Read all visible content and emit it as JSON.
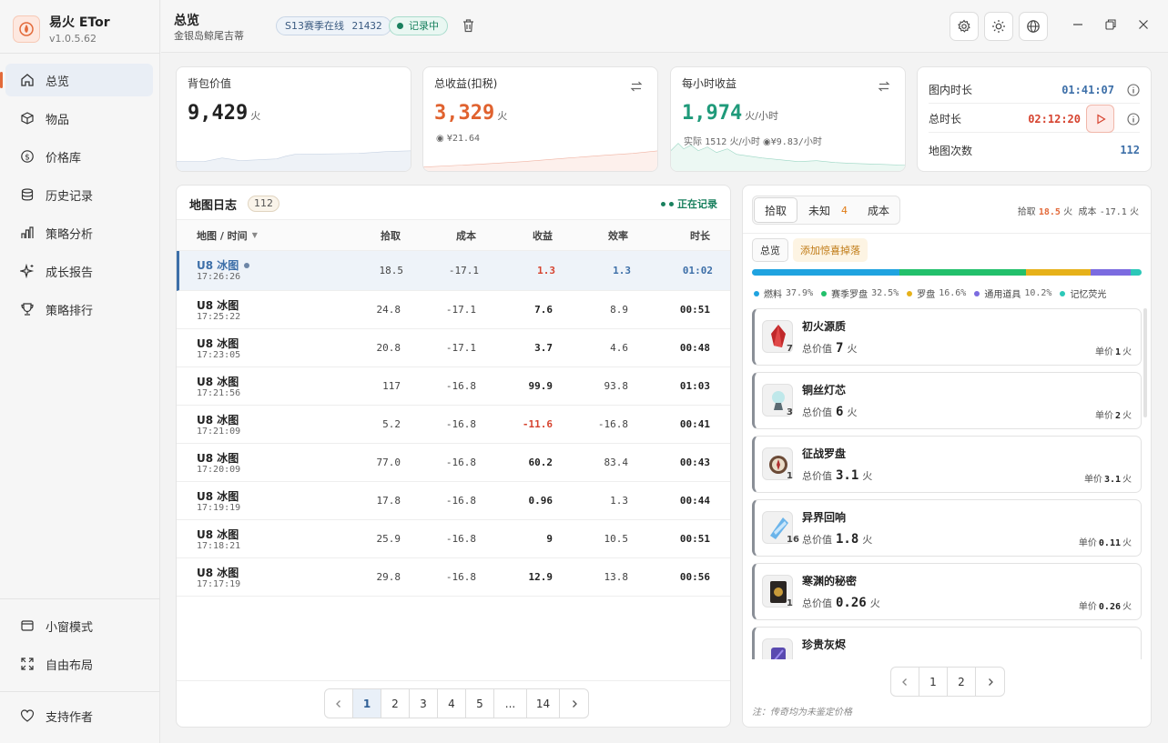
{
  "app": {
    "name": "易火 ETor",
    "version": "v1.0.5.62"
  },
  "sidebar": {
    "items": [
      {
        "label": "总览",
        "icon": "home-icon"
      },
      {
        "label": "物品",
        "icon": "box-icon"
      },
      {
        "label": "价格库",
        "icon": "dollar-icon"
      },
      {
        "label": "历史记录",
        "icon": "database-icon"
      },
      {
        "label": "策略分析",
        "icon": "bar-chart-icon"
      },
      {
        "label": "成长报告",
        "icon": "sparkle-icon"
      },
      {
        "label": "策略排行",
        "icon": "trophy-icon"
      }
    ],
    "bottom": [
      {
        "label": "小窗模式",
        "icon": "window-icon"
      },
      {
        "label": "自由布局",
        "icon": "expand-icon"
      },
      {
        "label": "支持作者",
        "icon": "heart-icon"
      }
    ]
  },
  "header": {
    "title": "总览",
    "subtitle": "金银岛鲸尾吉蒂",
    "season_label": "S13赛季在线",
    "season_count": "21432",
    "recording_label": "记录中"
  },
  "stats": {
    "bag": {
      "label": "背包价值",
      "value": "9,429",
      "unit": "火"
    },
    "profit": {
      "label": "总收益(扣税)",
      "value": "3,329",
      "unit": "火",
      "note": "¥21.64"
    },
    "hourly": {
      "label": "每小时收益",
      "value": "1,974",
      "unit": "火/小时",
      "note_label": "实际",
      "note_actual": "1512",
      "note_unit": "火/小时",
      "note_money": "¥9.83/小时"
    },
    "timers": {
      "in_map_label": "图内时长",
      "in_map_value": "01:41:07",
      "total_label": "总时长",
      "total_value": "02:12:20",
      "maps_label": "地图次数",
      "maps_value": "112"
    }
  },
  "map_log": {
    "title": "地图日志",
    "count": "112",
    "live_label": "正在记录",
    "columns": [
      "地图 / 时间",
      "拾取",
      "成本",
      "收益",
      "效率",
      "时长"
    ],
    "rows": [
      {
        "name": "U8 冰图",
        "time": "17:26:26",
        "pick": "18.5",
        "cost": "-17.1",
        "profit": "1.3",
        "eff": "1.3",
        "dur": "01:02"
      },
      {
        "name": "U8 冰图",
        "time": "17:25:22",
        "pick": "24.8",
        "cost": "-17.1",
        "profit": "7.6",
        "eff": "8.9",
        "dur": "00:51"
      },
      {
        "name": "U8 冰图",
        "time": "17:23:05",
        "pick": "20.8",
        "cost": "-17.1",
        "profit": "3.7",
        "eff": "4.6",
        "dur": "00:48"
      },
      {
        "name": "U8 冰图",
        "time": "17:21:56",
        "pick": "117",
        "cost": "-16.8",
        "profit": "99.9",
        "eff": "93.8",
        "dur": "01:03"
      },
      {
        "name": "U8 冰图",
        "time": "17:21:09",
        "pick": "5.2",
        "cost": "-16.8",
        "profit": "-11.6",
        "eff": "-16.8",
        "dur": "00:41"
      },
      {
        "name": "U8 冰图",
        "time": "17:20:09",
        "pick": "77.0",
        "cost": "-16.8",
        "profit": "60.2",
        "eff": "83.4",
        "dur": "00:43"
      },
      {
        "name": "U8 冰图",
        "time": "17:19:19",
        "pick": "17.8",
        "cost": "-16.8",
        "profit": "0.96",
        "eff": "1.3",
        "dur": "00:44"
      },
      {
        "name": "U8 冰图",
        "time": "17:18:21",
        "pick": "25.9",
        "cost": "-16.8",
        "profit": "9",
        "eff": "10.5",
        "dur": "00:51"
      },
      {
        "name": "U8 冰图",
        "time": "17:17:19",
        "pick": "29.8",
        "cost": "-16.8",
        "profit": "12.9",
        "eff": "13.8",
        "dur": "00:56"
      }
    ],
    "pages": [
      "1",
      "2",
      "3",
      "4",
      "5",
      "...",
      "14"
    ]
  },
  "loot": {
    "tabs": [
      {
        "label": "拾取"
      },
      {
        "label": "未知",
        "count": "4"
      },
      {
        "label": "成本"
      }
    ],
    "summary": {
      "pick_label": "拾取",
      "pick_value": "18.5",
      "pick_unit": "火",
      "cost_label": "成本",
      "cost_value": "-17.1",
      "cost_unit": "火"
    },
    "chip_overview": "总览",
    "chip_add": "添加惊喜掉落",
    "categories": [
      {
        "label": "燃料",
        "percent": "37.9%",
        "share": 37.9,
        "color": "#1fa3e0"
      },
      {
        "label": "赛季罗盘",
        "percent": "32.5%",
        "share": 32.5,
        "color": "#22c06b"
      },
      {
        "label": "罗盘",
        "percent": "16.6%",
        "share": 16.6,
        "color": "#e6b11a"
      },
      {
        "label": "通用道具",
        "percent": "10.2%",
        "share": 10.2,
        "color": "#7b6be0"
      },
      {
        "label": "记忆荧光",
        "percent": "",
        "share": 2.8,
        "color": "#2cc8b8"
      }
    ],
    "total_label": "总价值",
    "unit_label": "单价",
    "currency": "火",
    "items": [
      {
        "name": "初火源质",
        "qty": "7",
        "total": "7",
        "unit_price": "1",
        "icon": "red-crystal-icon"
      },
      {
        "name": "铜丝灯芯",
        "qty": "3",
        "total": "6",
        "unit_price": "2",
        "icon": "lamp-wick-icon"
      },
      {
        "name": "征战罗盘",
        "qty": "1",
        "total": "3.1",
        "unit_price": "3.1",
        "icon": "compass-icon"
      },
      {
        "name": "异界回响",
        "qty": "16",
        "total": "1.8",
        "unit_price": "0.11",
        "icon": "blue-shard-icon"
      },
      {
        "name": "寒渊的秘密",
        "qty": "1",
        "total": "0.26",
        "unit_price": "0.26",
        "icon": "dark-tome-icon"
      },
      {
        "name": "珍贵灰烬",
        "qty": "",
        "total": "",
        "unit_price": "",
        "icon": "purple-ash-icon"
      }
    ],
    "pages": [
      "1",
      "2"
    ],
    "footnote": "注：传奇均为未鉴定价格"
  },
  "colors": {
    "accent": "#e36a3a",
    "profit": "#e0622f",
    "hourly": "#1f9a7a",
    "timer_blue": "#3d6fa8",
    "timer_red": "#d6432f"
  }
}
